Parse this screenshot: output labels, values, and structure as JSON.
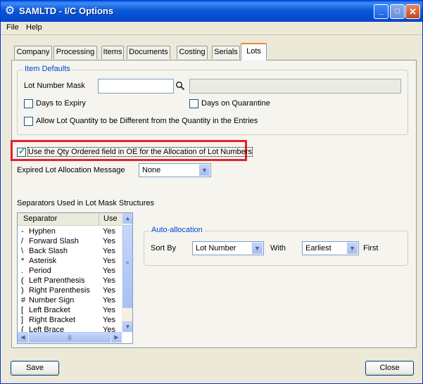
{
  "window": {
    "title": "SAMLTD - I/C Options"
  },
  "menu": [
    {
      "label": "File"
    },
    {
      "label": "Help"
    }
  ],
  "tabs": [
    {
      "label": "Company"
    },
    {
      "label": "Processing"
    },
    {
      "label": "Items"
    },
    {
      "label": "Documents"
    },
    {
      "label": "Costing"
    },
    {
      "label": "Serials"
    },
    {
      "label": "Lots"
    }
  ],
  "active_tab": "Lots",
  "item_defaults": {
    "legend": "Item Defaults",
    "lot_number_mask_label": "Lot Number Mask",
    "lot_number_mask_value": "",
    "lot_number_mask_desc": "",
    "days_to_expiry_label": "Days to Expiry",
    "days_to_expiry_checked": false,
    "days_on_quarantine_label": "Days on Quarantine",
    "days_on_quarantine_checked": false,
    "allow_lot_qty_label": "Allow Lot Quantity to be Different from the Quantity in the Entries",
    "allow_lot_qty_checked": false
  },
  "use_qty_ordered": {
    "label": "Use the Qty Ordered field in OE for the Allocation of Lot Numbers",
    "checked": true
  },
  "expired_lot": {
    "label": "Expired Lot Allocation Message",
    "value": "None"
  },
  "separators": {
    "title": "Separators Used in Lot Mask Structures",
    "columns": [
      "Separator",
      "Use"
    ],
    "rows": [
      {
        "symbol": "-",
        "name": "Hyphen",
        "use": "Yes"
      },
      {
        "symbol": "/",
        "name": "Forward Slash",
        "use": "Yes"
      },
      {
        "symbol": "\\",
        "name": "Back Slash",
        "use": "Yes"
      },
      {
        "symbol": "*",
        "name": "Asterisk",
        "use": "Yes"
      },
      {
        "symbol": ".",
        "name": "Period",
        "use": "Yes"
      },
      {
        "symbol": "(",
        "name": "Left Parenthesis",
        "use": "Yes"
      },
      {
        "symbol": ")",
        "name": "Right Parenthesis",
        "use": "Yes"
      },
      {
        "symbol": "#",
        "name": "Number Sign",
        "use": "Yes"
      },
      {
        "symbol": "[",
        "name": "Left Bracket",
        "use": "Yes"
      },
      {
        "symbol": "]",
        "name": "Right Bracket",
        "use": "Yes"
      },
      {
        "symbol": "{",
        "name": "Left Brace",
        "use": "Yes"
      }
    ]
  },
  "auto_allocation": {
    "legend": "Auto-allocation",
    "sort_by_label": "Sort By",
    "sort_by_value": "Lot Number",
    "with_label": "With",
    "with_value": "Earliest",
    "first_label": "First"
  },
  "buttons": {
    "save": "Save",
    "close": "Close"
  },
  "icons": {
    "app": "gear-icon",
    "finder": "magnifier-icon"
  },
  "colors": {
    "title_bar": "#0A5FE0",
    "highlight": "#E8212A",
    "legend": "#0046D5",
    "active_tab_accent": "#E68B2C"
  }
}
